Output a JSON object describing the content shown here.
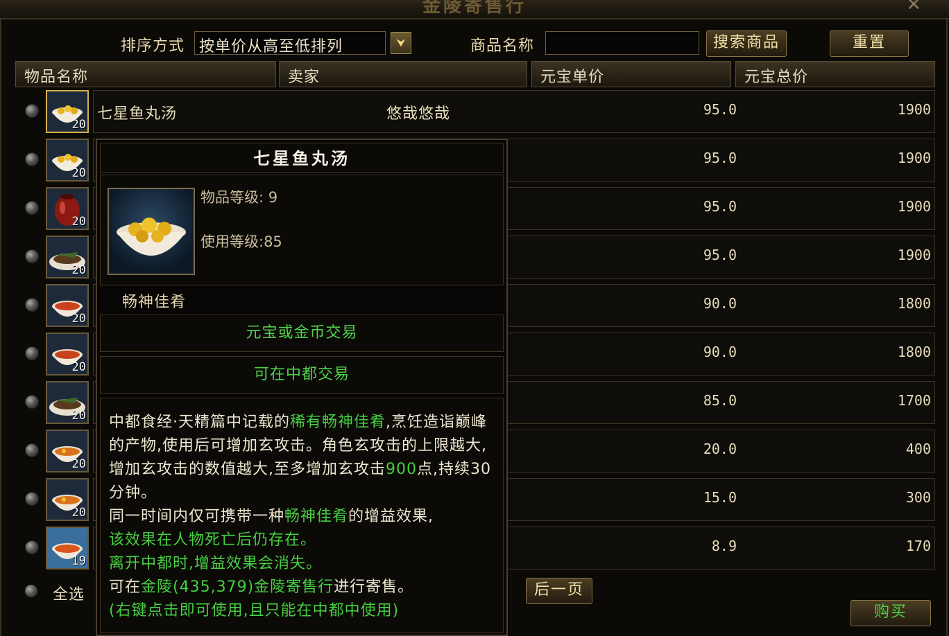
{
  "window": {
    "title": "金陵寄售行",
    "close_glyph": "✕"
  },
  "toolbar": {
    "sort_label": "排序方式",
    "sort_value": "按单价从高至低排列",
    "name_label": "商品名称",
    "name_value": "",
    "search_button": "搜索商品",
    "reset_button": "重置"
  },
  "table": {
    "headers": [
      "物品名称",
      "卖家",
      "元宝单价",
      "元宝总价"
    ],
    "rows": [
      {
        "name": "七星鱼丸汤",
        "seller": "悠哉悠哉",
        "unit": "95.0",
        "total": "1900",
        "count": "20",
        "icon": "fishball-soup-icon"
      },
      {
        "name": "",
        "seller": "",
        "unit": "95.0",
        "total": "1900",
        "count": "20",
        "icon": "fishball-soup-icon"
      },
      {
        "name": "",
        "seller": "",
        "unit": "95.0",
        "total": "1900",
        "count": "20",
        "icon": "red-jar-icon"
      },
      {
        "name": "",
        "seller": "",
        "unit": "95.0",
        "total": "1900",
        "count": "20",
        "icon": "fish-dish-icon"
      },
      {
        "name": "",
        "seller": "",
        "unit": "90.0",
        "total": "1800",
        "count": "20",
        "icon": "red-soup-icon"
      },
      {
        "name": "",
        "seller": "",
        "unit": "90.0",
        "total": "1800",
        "count": "20",
        "icon": "red-soup-icon"
      },
      {
        "name": "",
        "seller": "",
        "unit": "85.0",
        "total": "1700",
        "count": "20",
        "icon": "fish-dish-icon"
      },
      {
        "name": "",
        "seller": "",
        "unit": "20.0",
        "total": "400",
        "count": "20",
        "icon": "yellow-soup-icon"
      },
      {
        "name": "",
        "seller": "",
        "unit": "15.0",
        "total": "300",
        "count": "20",
        "icon": "yellow-soup-icon"
      },
      {
        "name": "",
        "seller": "",
        "unit": "8.9",
        "total": "170",
        "count": "19",
        "icon": "blue-bowl-icon"
      }
    ]
  },
  "bottom": {
    "select_all": "全选",
    "next_page": "后一页",
    "buy": "购买"
  },
  "tooltip": {
    "title": "七星鱼丸汤",
    "item_level": "物品等级: 9",
    "use_level": "使用等级:85",
    "subtitle": "畅神佳肴",
    "trade1": "元宝或金币交易",
    "trade2": "可在中都交易",
    "desc": {
      "p1a": "中都食经·天精篇中记载的",
      "p1g": "稀有畅神佳肴",
      "p1b": ",烹饪造诣巅峰的产物,使用后可增加玄攻击。角色玄攻击的上限越大,增加玄攻击的数值越大,至多增加玄攻击",
      "p1n": "900",
      "p1c": "点,持续30分钟。",
      "p2a": "同一时间内仅可携带一种",
      "p2g": "畅神佳肴",
      "p2b": "的增益效果,",
      "p3": "该效果在人物死亡后仍存在。",
      "p4": "离开中都时,增益效果会消失。",
      "p5a": "可在",
      "p5g": "金陵(435,379)金陵寄售行",
      "p5b": "进行寄售。",
      "p6": "(右键点击即可使用,且只能在中都中使用)"
    }
  },
  "colors": {
    "green_text": "#47cf42",
    "gold_border": "#d7b24a",
    "background": "#0b0a07"
  }
}
